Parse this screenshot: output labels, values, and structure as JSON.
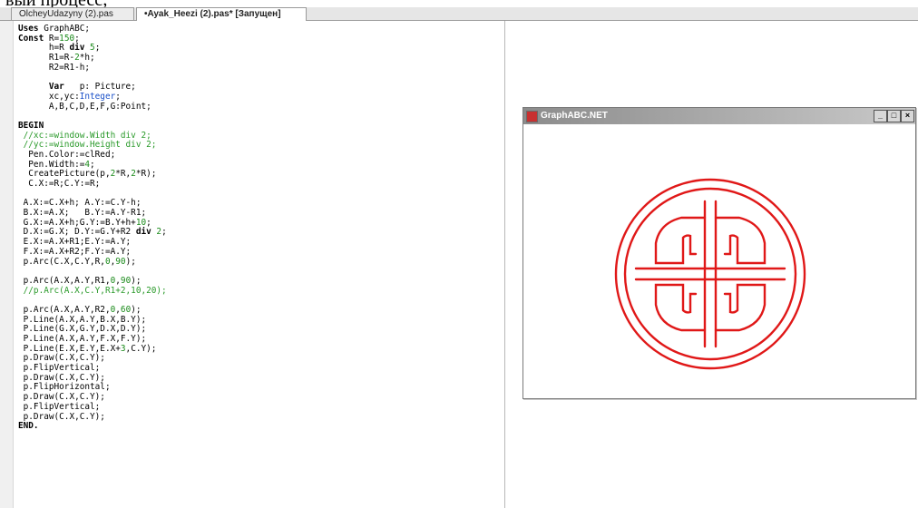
{
  "caption_fragment": "вый процесс;",
  "tabs": [
    {
      "label": "OlcheyUdazyny (2).pas"
    },
    {
      "label": "•Ayak_Heezi (2).pas* [Запущен]"
    }
  ],
  "code_lines": [
    [
      {
        "t": "Uses",
        "c": "kw"
      },
      {
        "t": " GraphABC;"
      }
    ],
    [
      {
        "t": "Const",
        "c": "kw"
      },
      {
        "t": " R="
      },
      {
        "t": "150",
        "c": "num"
      },
      {
        "t": ";"
      }
    ],
    [
      {
        "t": "      h=R "
      },
      {
        "t": "div",
        "c": "kw"
      },
      {
        "t": " "
      },
      {
        "t": "5",
        "c": "num"
      },
      {
        "t": ";"
      }
    ],
    [
      {
        "t": "      R1=R-"
      },
      {
        "t": "2",
        "c": "num"
      },
      {
        "t": "*h;"
      }
    ],
    [
      {
        "t": "      R2=R1-h;"
      }
    ],
    [
      {
        "t": ""
      }
    ],
    [
      {
        "t": "      "
      },
      {
        "t": "Var",
        "c": "kw"
      },
      {
        "t": "   p: Picture;"
      }
    ],
    [
      {
        "t": "      xc,yc:"
      },
      {
        "t": "Integer",
        "c": "ty"
      },
      {
        "t": ";"
      }
    ],
    [
      {
        "t": "      A,B,C,D,E,F,G:Point;"
      }
    ],
    [
      {
        "t": ""
      }
    ],
    [
      {
        "t": "BEGIN",
        "c": "kw"
      }
    ],
    [
      {
        "t": " //xc:=window.Width div 2;",
        "c": "cm"
      }
    ],
    [
      {
        "t": " //yc:=window.Height div 2;",
        "c": "cm"
      }
    ],
    [
      {
        "t": "  Pen.Color:=clRed;"
      }
    ],
    [
      {
        "t": "  Pen.Width:="
      },
      {
        "t": "4",
        "c": "num"
      },
      {
        "t": ";"
      }
    ],
    [
      {
        "t": "  CreatePicture(p,"
      },
      {
        "t": "2",
        "c": "num"
      },
      {
        "t": "*R,"
      },
      {
        "t": "2",
        "c": "num"
      },
      {
        "t": "*R);"
      }
    ],
    [
      {
        "t": "  C.X:=R;C.Y:=R;"
      }
    ],
    [
      {
        "t": ""
      }
    ],
    [
      {
        "t": " A.X:=C.X+h; A.Y:=C.Y-h;"
      }
    ],
    [
      {
        "t": " B.X:=A.X;   B.Y:=A.Y-R1;"
      }
    ],
    [
      {
        "t": " G.X:=A.X+h;G.Y:=B.Y+h+"
      },
      {
        "t": "10",
        "c": "num"
      },
      {
        "t": ";"
      }
    ],
    [
      {
        "t": " D.X:=G.X; D.Y:=G.Y+R2 "
      },
      {
        "t": "div",
        "c": "kw"
      },
      {
        "t": " "
      },
      {
        "t": "2",
        "c": "num"
      },
      {
        "t": ";"
      }
    ],
    [
      {
        "t": " E.X:=A.X+R1;E.Y:=A.Y;"
      }
    ],
    [
      {
        "t": " F.X:=A.X+R2;F.Y:=A.Y;"
      }
    ],
    [
      {
        "t": " p.Arc(C.X,C.Y,R,"
      },
      {
        "t": "0",
        "c": "num"
      },
      {
        "t": ","
      },
      {
        "t": "90",
        "c": "num"
      },
      {
        "t": ");"
      }
    ],
    [
      {
        "t": ""
      }
    ],
    [
      {
        "t": " p.Arc(A.X,A.Y,R1,"
      },
      {
        "t": "0",
        "c": "num"
      },
      {
        "t": ","
      },
      {
        "t": "90",
        "c": "num"
      },
      {
        "t": ");"
      }
    ],
    [
      {
        "t": " //p.Arc(A.X,C.Y,R1+2,10,20);",
        "c": "cm"
      }
    ],
    [
      {
        "t": ""
      }
    ],
    [
      {
        "t": " p.Arc(A.X,A.Y,R2,"
      },
      {
        "t": "0",
        "c": "num"
      },
      {
        "t": ","
      },
      {
        "t": "60",
        "c": "num"
      },
      {
        "t": ");"
      }
    ],
    [
      {
        "t": " P.Line(A.X,A.Y,B.X,B.Y);"
      }
    ],
    [
      {
        "t": " P.Line(G.X,G.Y,D.X,D.Y);"
      }
    ],
    [
      {
        "t": " P.Line(A.X,A.Y,F.X,F.Y);"
      }
    ],
    [
      {
        "t": " P.Line(E.X,E.Y,E.X+"
      },
      {
        "t": "3",
        "c": "num"
      },
      {
        "t": ",C.Y);"
      }
    ],
    [
      {
        "t": " p.Draw(C.X,C.Y);"
      }
    ],
    [
      {
        "t": " p.FlipVertical;"
      }
    ],
    [
      {
        "t": " p.Draw(C.X,C.Y);"
      }
    ],
    [
      {
        "t": " p.FlipHorizontal;"
      }
    ],
    [
      {
        "t": " p.Draw(C.X,C.Y);"
      }
    ],
    [
      {
        "t": " p.FlipVertical;"
      }
    ],
    [
      {
        "t": " p.Draw(C.X,C.Y);"
      }
    ],
    [
      {
        "t": "END.",
        "c": "kw"
      }
    ]
  ],
  "output_window": {
    "title": "GraphABC.NET",
    "minimize_label": "_",
    "maximize_label": "□",
    "close_label": "×",
    "stroke_color": "#e01818",
    "background_color": "#ffffff"
  }
}
